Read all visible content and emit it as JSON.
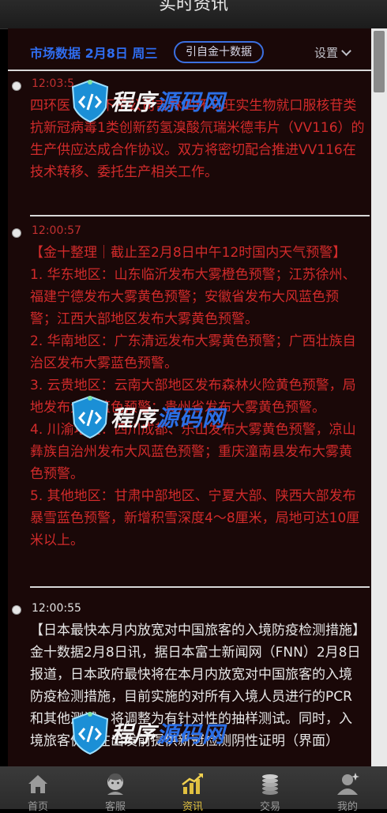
{
  "page_title": "实时资讯",
  "header": {
    "market_title": "市场数据 2月8日 周三",
    "source_label": "引自金十数据",
    "settings_label": "设置"
  },
  "news": [
    {
      "time": "12:03:5",
      "text": "四环医  ：旗下子公司吉林四环与旺实生物就口服核苷类抗新冠病毒1类创新药氢溴酸氘瑞米德韦片（VV116）的生产供应达成合作协议。双方将密切配合推进VV116在技术转移、委托生产相关工作。"
    },
    {
      "time": "12:00:57",
      "text": "【金十整理｜截止至2月8日中午12时国内天气预警】\n1. 华东地区：山东临沂发布大雾橙色预警；江苏徐州、福建宁德发布大雾黄色预警；安徽省发布大风蓝色预警；江西大部地区发布大雾黄色预警。\n2. 华南地区：广东清远发布大雾黄色预警；广西壮族自治区发布大雾蓝色预警。\n3. 云贵地区：云南大部地区发布森林火险黄色预警，局地发布大风蓝色预警；贵州省发布大雾黄色预警。\n4. 川渝地区：四川成都、乐山发布大雾黄色预警，凉山彝族自治州发布大风蓝色预警；重庆潼南县发布大雾黄色预警。\n5. 其他地区：甘肃中部地区、宁夏大部、陕西大部发布暴雪蓝色预警，新增积雪深度4～8厘米，局地可达10厘米以上。"
    },
    {
      "time": "12:00:55",
      "text": "【日本最快本月内放宽对中国旅客的入境防疫检测措施】金十数据2月8日讯，据日本富士新闻网（FNN）2月8日报道，日本政府最快将在本月内放宽对中国旅客的入境防疫检测措施，目前实施的对所有入境人员进行的PCR和其他测试，将调整为有针对性的抽样测试。同时，入境旅客仍须在出发前提供新冠检测阴性证明（界面）"
    }
  ],
  "nav": [
    {
      "label": "首页",
      "icon": "home-icon"
    },
    {
      "label": "客服",
      "icon": "customer-service-icon"
    },
    {
      "label": "资讯",
      "icon": "chart-icon"
    },
    {
      "label": "交易",
      "icon": "coins-icon"
    },
    {
      "label": "我的",
      "icon": "user-icon"
    }
  ],
  "watermark": {
    "text_a": "程序",
    "text_b": "源码网"
  },
  "colors": {
    "accent_blue": "#2f6df0",
    "news_red": "#d22b2b",
    "active_tab": "#e0c040",
    "background": "#1a0808"
  }
}
